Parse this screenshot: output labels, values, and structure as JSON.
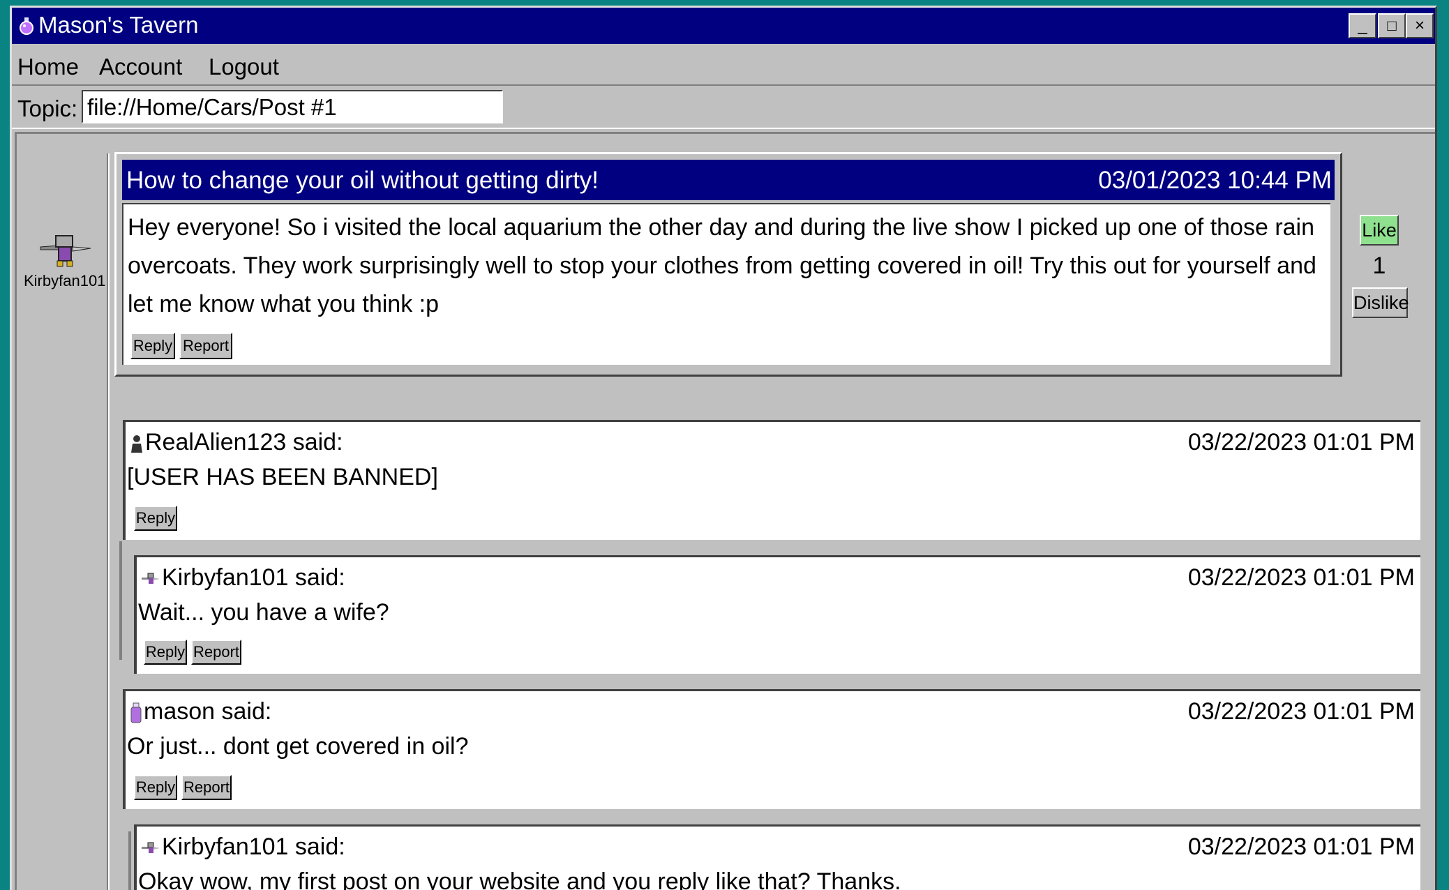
{
  "window": {
    "title": "Mason's Tavern",
    "minimize": "_",
    "maximize": "□",
    "close": "×"
  },
  "menu": {
    "home": "Home",
    "account": "Account",
    "logout": "Logout"
  },
  "topic": {
    "label": "Topic:",
    "value": "file://Home/Cars/Post #1"
  },
  "post": {
    "author": "Kirbyfan101",
    "title": "How to change your oil without getting dirty!",
    "date": "03/01/2023 10:44 PM",
    "body": "Hey everyone! So i visited the local aquarium the other day and during the live show I picked up one of those rain overcoats. They work surprisingly well to stop your clothes from getting covered in oil! Try this out for yourself and let me know what you think :p",
    "reply_label": "Reply",
    "report_label": "Report",
    "like_label": "Like",
    "like_count": "1",
    "dislike_label": "Dislike"
  },
  "replies": [
    {
      "user": "RealAlien123 said:",
      "date": "03/22/2023 01:01 PM",
      "text": "[USER HAS BEEN BANNED]",
      "reply_label": "Reply",
      "icon": "person-icon"
    },
    {
      "user": "Kirbyfan101 said:",
      "date": "03/22/2023 01:01 PM",
      "text": "Wait... you have a wife?",
      "reply_label": "Reply",
      "report_label": "Report",
      "icon": "kirby-knight-icon"
    },
    {
      "user": "mason said:",
      "date": "03/22/2023 01:01 PM",
      "text": "Or just... dont get covered in oil?",
      "reply_label": "Reply",
      "report_label": "Report",
      "icon": "potion-icon"
    },
    {
      "user": "Kirbyfan101 said:",
      "date": "03/22/2023 01:01 PM",
      "text": "Okay wow, my first post on your website and you reply like that? Thanks.",
      "icon": "kirby-knight-icon"
    }
  ],
  "colors": {
    "desktop": "#0a8482",
    "titlebar": "#000080",
    "like": "#8fe08f",
    "chrome": "#c0c0c0"
  }
}
